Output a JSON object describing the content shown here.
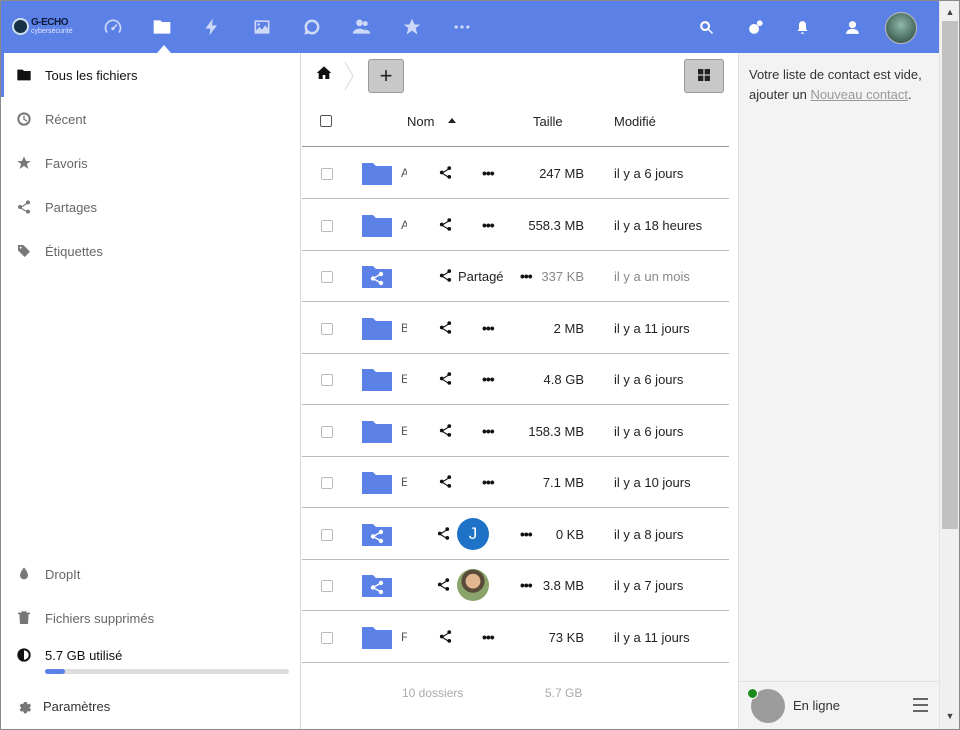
{
  "brand": {
    "name": "G-ECHO",
    "tagline": "cybersécurité"
  },
  "apps": [
    {
      "name": "dashboard-icon"
    },
    {
      "name": "files-icon",
      "active": true
    },
    {
      "name": "activity-icon"
    },
    {
      "name": "gallery-icon"
    },
    {
      "name": "talk-icon"
    },
    {
      "name": "contacts-icon"
    },
    {
      "name": "favorites-icon"
    },
    {
      "name": "more-apps-icon"
    }
  ],
  "header_right": [
    "search-icon",
    "circles-icon",
    "notifications-icon",
    "contacts-menu-icon",
    "user-avatar"
  ],
  "sidebar": {
    "items": [
      {
        "label": "Tous les fichiers",
        "icon": "folder-icon",
        "active": true
      },
      {
        "label": "Récent",
        "icon": "clock-icon"
      },
      {
        "label": "Favoris",
        "icon": "star-icon"
      },
      {
        "label": "Partages",
        "icon": "share-icon"
      },
      {
        "label": "Étiquettes",
        "icon": "tag-icon"
      }
    ],
    "bottom": [
      {
        "label": "DropIt",
        "icon": "drop-icon"
      },
      {
        "label": "Fichiers supprimés",
        "icon": "trash-icon"
      }
    ],
    "quota": {
      "label": "5.7 GB utilisé",
      "used_fraction": 0.08
    },
    "settings_label": "Paramètres"
  },
  "files": {
    "columns": {
      "name": "Nom",
      "size": "Taille",
      "modified": "Modifié"
    },
    "rows": [
      {
        "name": "A",
        "type": "folder",
        "size": "247 MB",
        "modified": "il y a 6 jours"
      },
      {
        "name": "A",
        "type": "folder",
        "size": "558.3 MB",
        "modified": "il y a 18 heures"
      },
      {
        "name": "",
        "type": "shared-folder",
        "shared_label": "Partagé",
        "size": "337 KB",
        "modified": "il y a un mois",
        "faded": true
      },
      {
        "name": "B",
        "type": "folder",
        "size": "2 MB",
        "modified": "il y a 11 jours"
      },
      {
        "name": "E",
        "type": "folder",
        "size": "4.8 GB",
        "modified": "il y a 6 jours"
      },
      {
        "name": "E",
        "type": "folder",
        "size": "158.3 MB",
        "modified": "il y a 6 jours"
      },
      {
        "name": "E",
        "type": "folder",
        "size": "7.1 MB",
        "modified": "il y a 10 jours"
      },
      {
        "name": "",
        "type": "shared-folder",
        "owner_initial": "J",
        "size": "0 KB",
        "modified": "il y a 8 jours"
      },
      {
        "name": "",
        "type": "shared-folder",
        "owner_photo": true,
        "size": "3.8 MB",
        "modified": "il y a 7 jours"
      },
      {
        "name": "F",
        "type": "folder",
        "size": "73 KB",
        "modified": "il y a 11 jours"
      }
    ],
    "summary": {
      "count": "10 dossiers",
      "total": "5.7 GB"
    }
  },
  "contacts": {
    "message_prefix": "Votre liste de contact est vide, ajouter un ",
    "link": "Nouveau contact",
    "message_suffix": ".",
    "status": "En ligne"
  },
  "colors": {
    "accent": "#5b80e6",
    "folder": "#5b80e6",
    "online": "#1a8a1a",
    "avatar_j": "#1e73c8"
  }
}
